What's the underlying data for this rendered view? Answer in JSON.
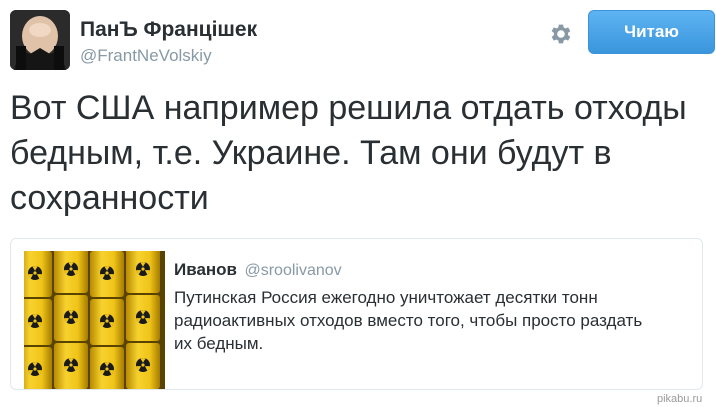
{
  "tweet": {
    "author_name": "ПанЪ Францішек",
    "author_handle": "@FrantNeVolskiy",
    "follow_label": "Читаю",
    "settings_icon": "gear-icon",
    "text": "Вот США например решила отдать отходы бедным, т.е. Украине. Там они будут в сохранности"
  },
  "quoted_tweet": {
    "author_name": "Иванов",
    "author_handle": "@sroolivanov",
    "text": "Путинская Россия ежегодно уничтожает десятки тонн радиоактивных отходов вместо того, чтобы просто раздать их бедным.",
    "media_icon": "radioactive-barrels-image"
  },
  "watermark": "pikabu.ru",
  "colors": {
    "follow_button": "#3a95dc",
    "text": "#292f33",
    "secondary_text": "#8899a6",
    "barrels": "#f0c419"
  }
}
